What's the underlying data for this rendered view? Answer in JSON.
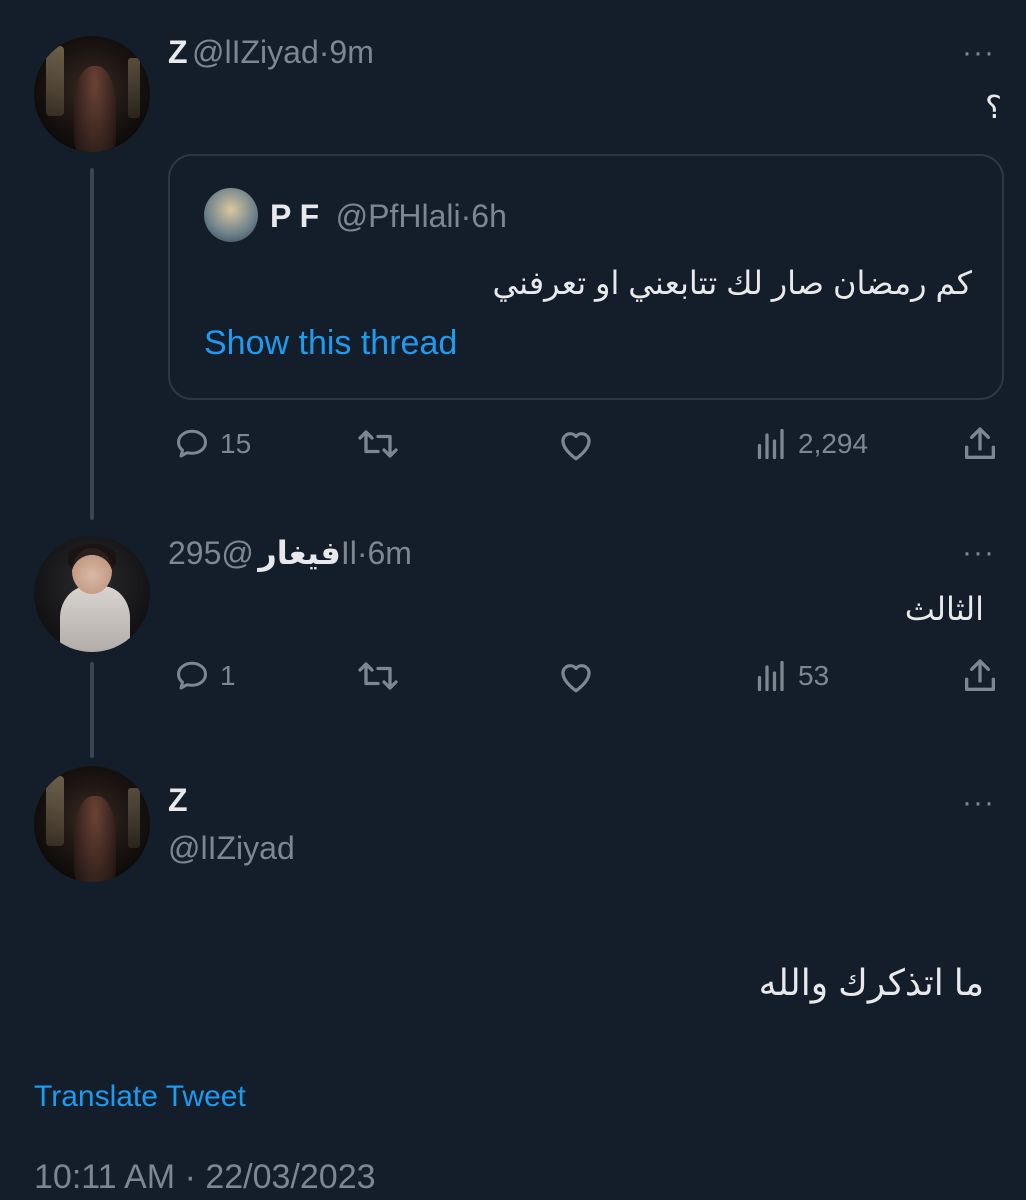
{
  "tweet1": {
    "name": "Z",
    "handle": "@lIZiyad",
    "time": "9m",
    "text": "؟",
    "quote": {
      "name": "P F",
      "handle": "@PfHlali",
      "time": "6h",
      "text": "كم رمضان صار لك تتابعني او تعرفني",
      "show_thread": "Show this thread"
    },
    "replies": "15",
    "views": "2,294"
  },
  "tweet2": {
    "name": "فيغار",
    "handle": "@295Il",
    "time": "6m",
    "text": "الثالث",
    "replies": "1",
    "views": "53"
  },
  "tweet3": {
    "name": "Z",
    "handle": "@lIZiyad",
    "text": "ما اتذكرك والله",
    "translate": "Translate Tweet",
    "timestamp": "10:11 AM · 22/03/2023"
  },
  "separator": "·",
  "more": "···",
  "icons": [
    "reply-icon",
    "retweet-icon",
    "like-icon",
    "views-icon",
    "share-icon",
    "more-icon"
  ],
  "colors": {
    "background": "#141d2a",
    "text": "#e7e9ea",
    "muted": "#7d8792",
    "link": "#1d9bf0",
    "border": "#2d3846"
  }
}
